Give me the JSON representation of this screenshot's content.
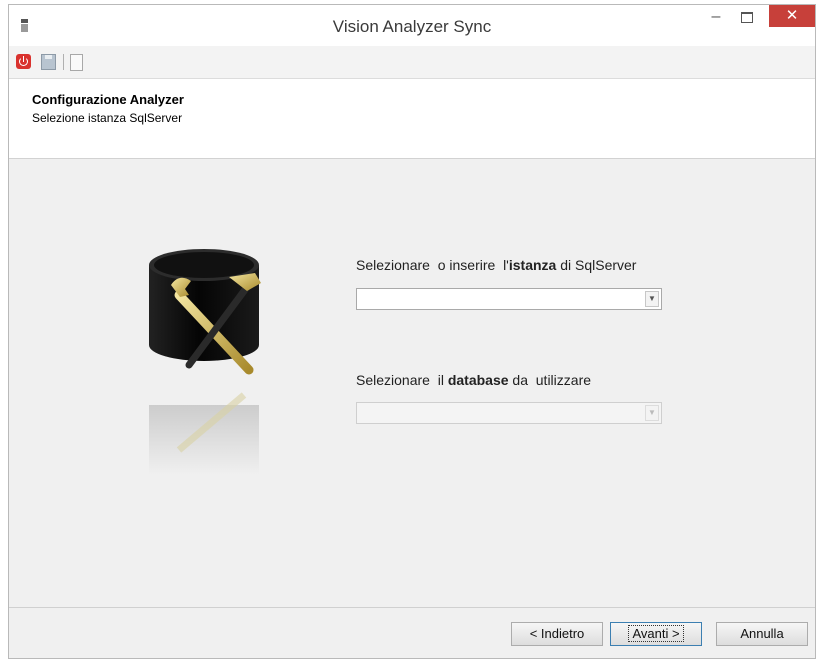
{
  "window": {
    "title": "Vision Analyzer Sync",
    "minimize": "–",
    "close": "✕"
  },
  "toolbar": {
    "icons": [
      "power-icon",
      "save-icon",
      "document-icon"
    ]
  },
  "header": {
    "title": "Configurazione Analyzer",
    "subtitle": "Selezione istanza SqlServer"
  },
  "main": {
    "instance_label_pre": "Selezionare  o inserire  l'",
    "instance_label_bold": "istanza",
    "instance_label_post": " di SqlServer",
    "instance_value": "",
    "database_label_pre": "Selezionare  il ",
    "database_label_bold": "database",
    "database_label_post": " da  utilizzare",
    "database_value": "",
    "dropdown_arrow": "▼",
    "illustration": "database-tools-icon"
  },
  "buttons": {
    "back": "< Indietro",
    "next": "Avanti >",
    "cancel": "Annulla"
  },
  "colors": {
    "close_button": "#c7403a",
    "power_icon": "#d9322e",
    "background": "#f0f0f0"
  }
}
